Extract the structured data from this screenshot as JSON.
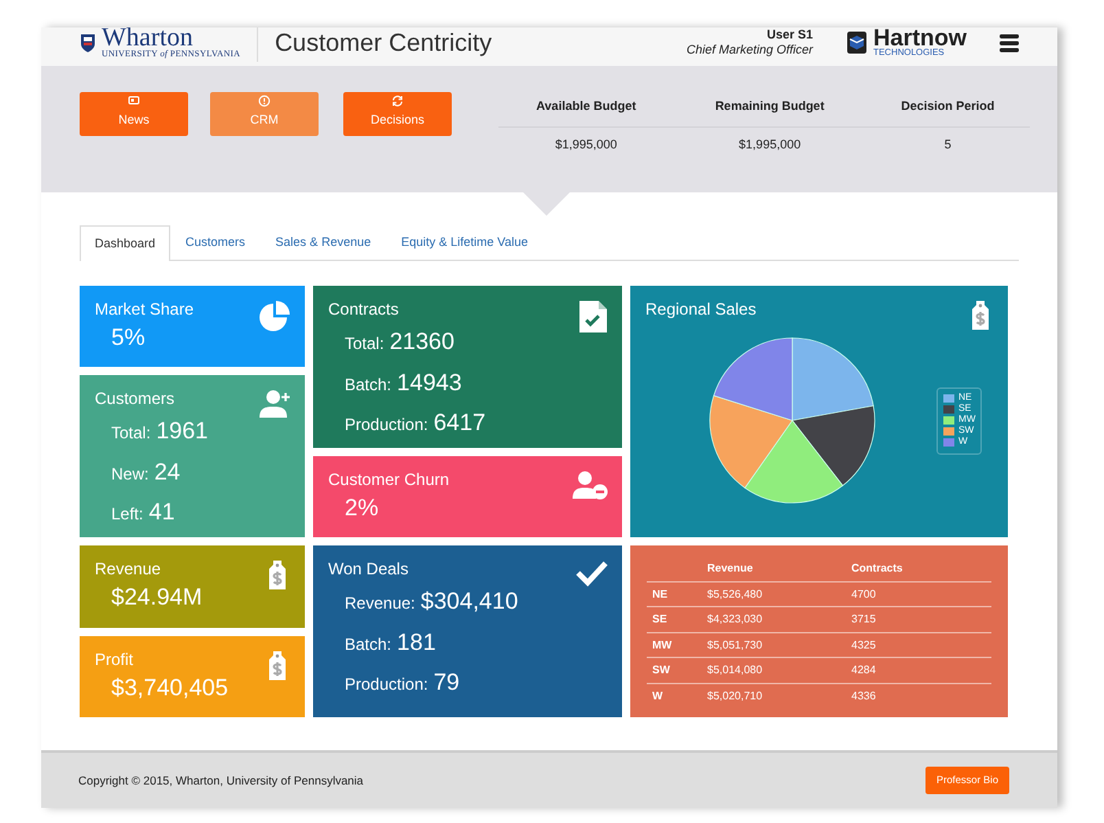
{
  "header": {
    "school": "Wharton",
    "school_sub": "UNIVERSITY *of* PENNSYLVANIA",
    "app_title": "Customer Centricity",
    "user": "User S1",
    "role": "Chief Marketing Officer",
    "company": "Hartnow",
    "company_sub": "TECHNOLOGIES"
  },
  "actions": [
    {
      "label": "News",
      "selected": false
    },
    {
      "label": "CRM",
      "selected": true
    },
    {
      "label": "Decisions",
      "selected": false
    }
  ],
  "budget": {
    "columns": [
      "Available Budget",
      "Remaining Budget",
      "Decision Period"
    ],
    "values": [
      "$1,995,000",
      "$1,995,000",
      "5"
    ]
  },
  "tabs": [
    {
      "label": "Dashboard",
      "selected": true
    },
    {
      "label": "Customers",
      "selected": false
    },
    {
      "label": "Sales & Revenue",
      "selected": false
    },
    {
      "label": "Equity & Lifetime Value",
      "selected": false
    }
  ],
  "tiles": [
    {
      "title": "Market Share",
      "kind": "value",
      "value": "5%"
    },
    {
      "title": "Contracts",
      "kind": "list",
      "lines": [
        {
          "label": "Total:",
          "value": "21360"
        },
        {
          "label": "Batch:",
          "value": "14943"
        },
        {
          "label": "Production:",
          "value": "6417"
        }
      ]
    },
    {
      "title": "Regional Sales",
      "kind": "pie",
      "legend": [
        {
          "label": "NE",
          "color": "#7cb5ec"
        },
        {
          "label": "SE",
          "color": "#434348"
        },
        {
          "label": "MW",
          "color": "#90ed7d"
        },
        {
          "label": "SW",
          "color": "#f7a35c"
        },
        {
          "label": "W",
          "color": "#8085e9"
        }
      ]
    },
    {
      "title": "Customers",
      "kind": "list",
      "lines": [
        {
          "label": "Total:",
          "value": "1961"
        },
        {
          "label": "New:",
          "value": "24"
        },
        {
          "label": "Left:",
          "value": "41"
        }
      ]
    },
    {
      "title": "Customer Churn",
      "kind": "value",
      "value": "2%"
    },
    {
      "title": "Revenue",
      "kind": "value",
      "value": "$24.94M"
    },
    {
      "title": "Profit",
      "kind": "value",
      "value": "$3,740,405"
    },
    {
      "title": "Won Deals",
      "kind": "list",
      "lines": [
        {
          "label": "Revenue:",
          "value": "$304,410"
        },
        {
          "label": "Batch:",
          "value": "181"
        },
        {
          "label": "Production:",
          "value": "79"
        }
      ]
    },
    {
      "kind": "table",
      "columns": [
        "",
        "Revenue",
        "Contracts"
      ],
      "rows": [
        [
          "NE",
          "$5,526,480",
          "4700"
        ],
        [
          "SE",
          "$4,323,030",
          "3715"
        ],
        [
          "MW",
          "$5,051,730",
          "4325"
        ],
        [
          "SW",
          "$5,014,080",
          "4284"
        ],
        [
          "W",
          "$5,020,710",
          "4336"
        ]
      ]
    }
  ],
  "footer": {
    "copyright": "Copyright © 2015, Wharton, University of Pennsylvania",
    "button": "Professor Bio"
  }
}
